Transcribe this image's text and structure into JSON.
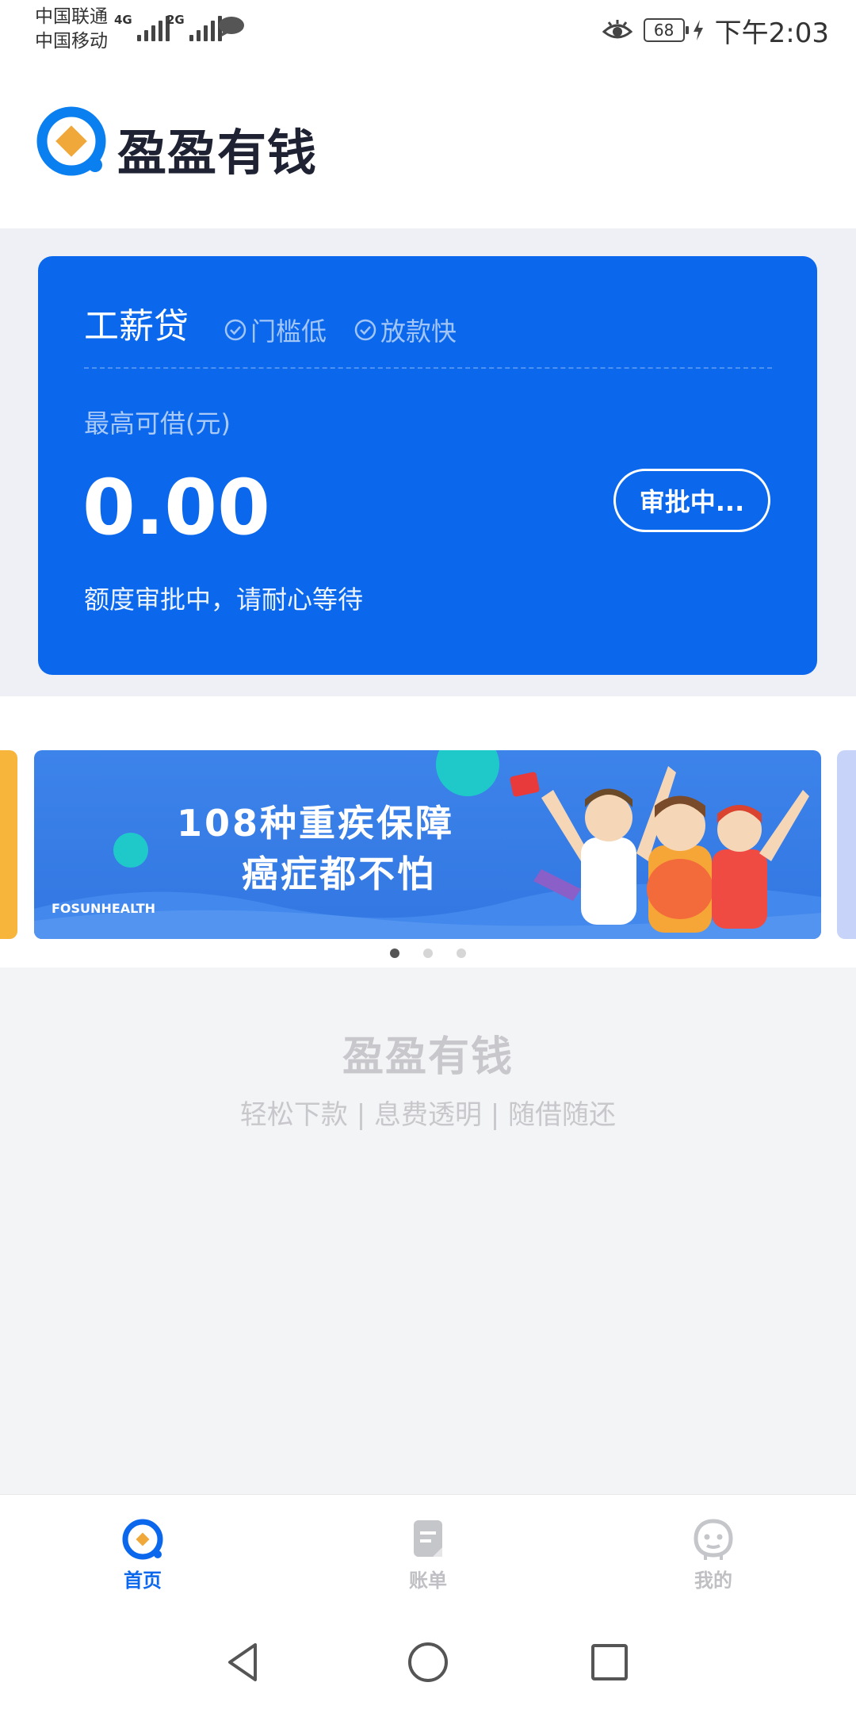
{
  "status_bar": {
    "carrier1": "中国联通",
    "carrier2": "中国移动",
    "net1": "4G",
    "net2": "2G",
    "battery": "68",
    "time": "下午2:03"
  },
  "header": {
    "app_name": "盈盈有钱"
  },
  "loan_card": {
    "title": "工薪贷",
    "tags": [
      "门槛低",
      "放款快"
    ],
    "limit_label": "最高可借(元)",
    "limit_value": "0.00",
    "status_button": "审批中...",
    "hint": "额度审批中，请耐心等待",
    "color": "#0b68ec"
  },
  "banner": {
    "line1": "108种重疾保障",
    "line2": "癌症都不怕",
    "brand": "FOSUNHEALTH",
    "active_slide": 1,
    "slides": 3
  },
  "footer": {
    "title": "盈盈有钱",
    "tagline": "轻松下款 | 息费透明 | 随借随还"
  },
  "bottom_nav": {
    "items": [
      {
        "label": "首页",
        "icon": "home-icon",
        "active": true
      },
      {
        "label": "账单",
        "icon": "bill-icon",
        "active": false
      },
      {
        "label": "我的",
        "icon": "profile-icon",
        "active": false
      }
    ]
  },
  "system_nav": {
    "icons": [
      "back-icon",
      "home-circle-icon",
      "recents-icon"
    ]
  }
}
